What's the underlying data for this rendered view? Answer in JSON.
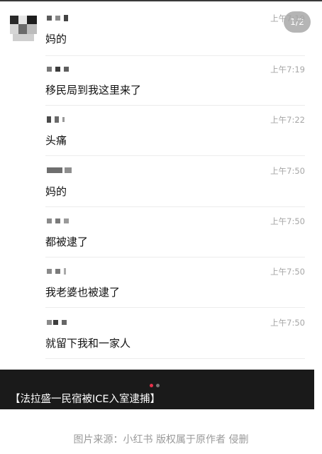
{
  "pager": "1/2",
  "messages": [
    {
      "time": "上午7:19",
      "text": "妈的"
    },
    {
      "time": "上午7:19",
      "text": "移民局到我这里来了"
    },
    {
      "time": "上午7:22",
      "text": "头痛"
    },
    {
      "time": "上午7:50",
      "text": "妈的"
    },
    {
      "time": "上午7:50",
      "text": "都被逮了"
    },
    {
      "time": "上午7:50",
      "text": "我老婆也被逮了"
    },
    {
      "time": "上午7:50",
      "text": "就留下我和一家人"
    }
  ],
  "caption": "【法拉盛一民宿被ICE入室逮捕】",
  "source": "图片来源：小红书 版权属于原作者 侵删",
  "colors": {
    "bar": "#1a1a1a",
    "active_dot": "#e8304a",
    "inactive_dot": "#777777",
    "timestamp": "#a6a6a6",
    "pager_bg": "rgba(120,120,120,0.55)"
  },
  "icons": [
    "avatar",
    "pagination-dots"
  ]
}
